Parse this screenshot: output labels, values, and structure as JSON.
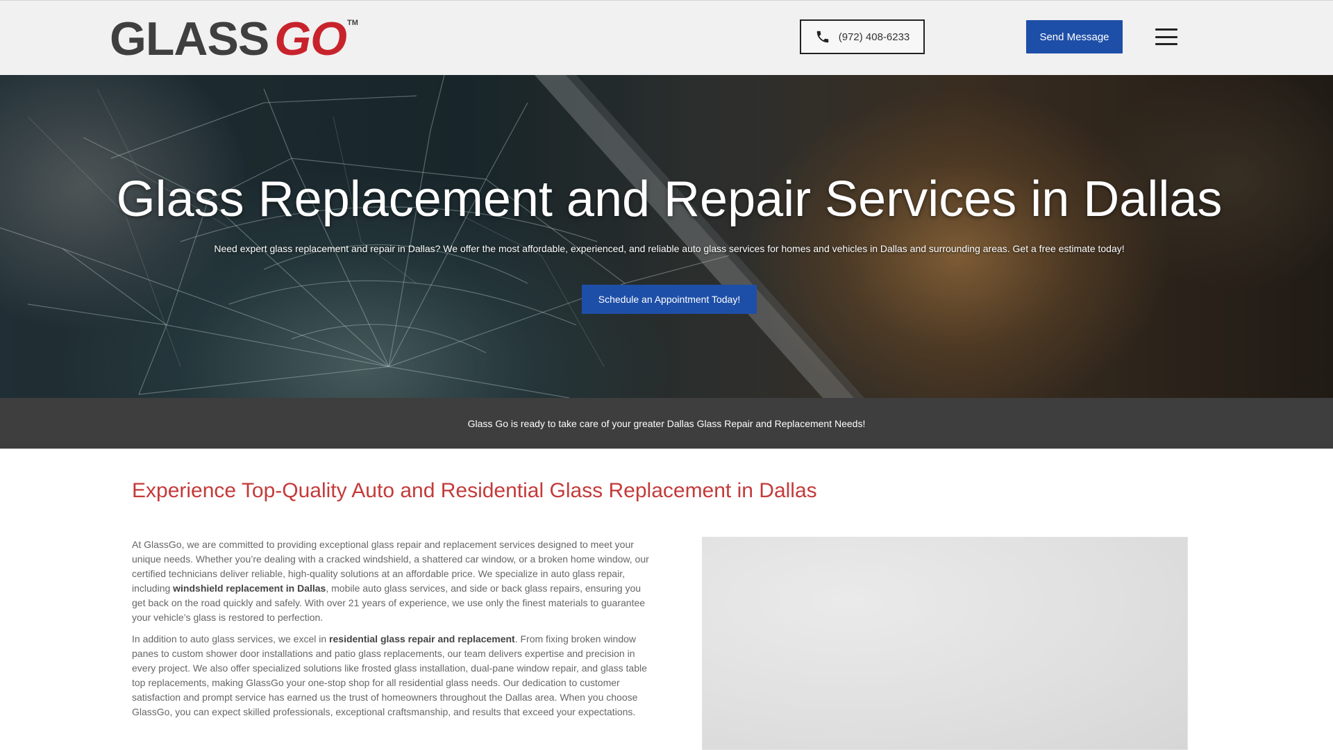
{
  "header": {
    "logo": {
      "part1": "GLASS",
      "part2": "GO",
      "trademark": "TM"
    },
    "phone": {
      "label": "(972) 408-6233",
      "icon": "phone-icon"
    },
    "send_message_label": "Send Message",
    "menu_icon": "hamburger-menu-icon"
  },
  "hero": {
    "title": "Glass Replacement and Repair Services in Dallas",
    "subtitle": "Need expert glass replacement and repair in Dallas? We offer the most affordable, experienced, and reliable auto glass services for homes and vehicles in Dallas and surrounding areas. Get a free estimate today!",
    "cta_label": "Schedule an Appointment Today!"
  },
  "band": {
    "text": "Glass Go is ready to take care of your greater Dallas Glass Repair and Replacement Needs!"
  },
  "content": {
    "title": "Experience Top-Quality Auto and Residential Glass Replacement in Dallas",
    "p1_a": "At GlassGo, we are committed to providing exceptional glass repair and replacement services designed to meet your unique needs. Whether you’re dealing with a cracked windshield, a shattered car window, or a broken home window, our certified technicians deliver reliable, high-quality solutions at an affordable price. We specialize in auto glass repair, including ",
    "p1_bold": "windshield replacement in Dallas",
    "p1_b": ", mobile auto glass services, and side or back glass repairs, ensuring you get back on the road quickly and safely. With over 21 years of experience, we use only the finest materials to guarantee your vehicle’s glass is restored to perfection.",
    "p2_a": "In addition to auto glass services, we excel in ",
    "p2_bold": "residential glass repair and replacement",
    "p2_b": ". From fixing broken window panes to custom shower door installations and patio glass replacements, our team delivers expertise and precision in every project. We also offer specialized solutions like frosted glass installation, dual-pane window repair, and glass table top replacements, making GlassGo your one-stop shop for all residential glass needs. Our dedication to customer satisfaction and prompt service has earned us the trust of homeowners throughout the Dallas area. When you choose GlassGo, you can expect skilled professionals, exceptional craftsmanship, and results that exceed your expectations."
  },
  "colors": {
    "brand_blue": "#1e4fa8",
    "brand_red": "#c8232c",
    "heading_red": "#c43a3a",
    "band_dark": "#3e3e3e",
    "header_bg": "#f1f1f1"
  }
}
